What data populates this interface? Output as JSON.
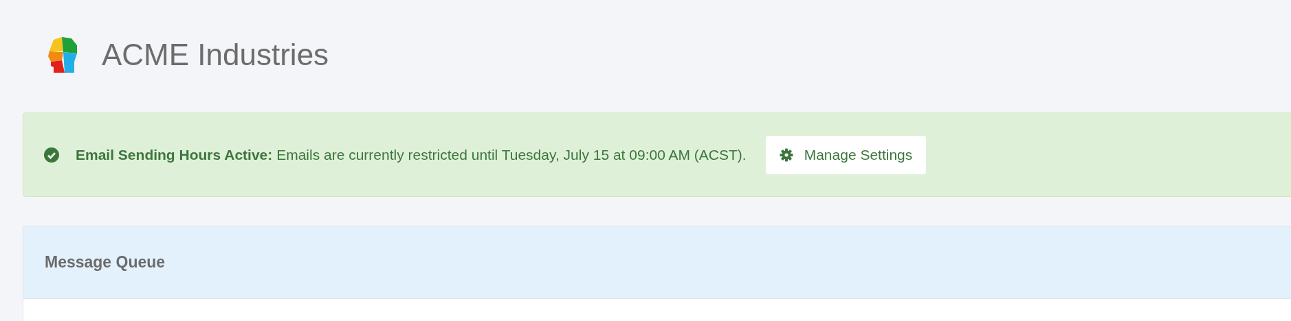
{
  "header": {
    "title": "ACME Industries"
  },
  "alert": {
    "title": "Email Sending Hours Active:",
    "message": "Emails are currently restricted until Tuesday, July 15 at 09:00 AM (ACST).",
    "button": "Manage Settings"
  },
  "panel": {
    "title": "Message Queue"
  }
}
